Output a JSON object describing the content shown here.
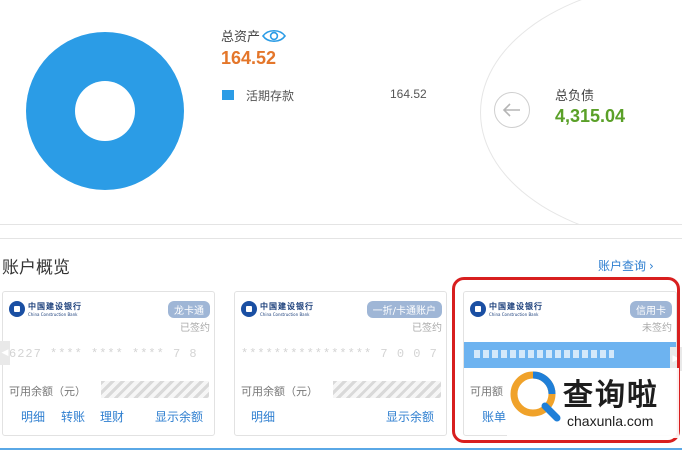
{
  "colors": {
    "donut": "#2b9ce6",
    "asset_value": "#e4762a",
    "liability_value": "#5aa028",
    "link": "#2f7fd0",
    "highlight": "#d81f1f"
  },
  "summary": {
    "asset_title": "总资产",
    "asset_value": "164.52",
    "legend": [
      {
        "label": "活期存款",
        "value": "164.52"
      }
    ],
    "liability_title": "总负债",
    "liability_value": "4,315.04"
  },
  "overview": {
    "title": "账户概览",
    "query_link": "账户查询",
    "cards": [
      {
        "bank_cn": "中国建设银行",
        "bank_en": "China Construction Bank",
        "badge": "龙卡通",
        "status": "已签约",
        "masked_number": "6227 **** **** **** 7 8",
        "balance_label": "可用余额（元）",
        "actions": [
          "明细",
          "转账",
          "理财",
          "显示余额"
        ]
      },
      {
        "bank_cn": "中国建设银行",
        "bank_en": "China Construction Bank",
        "badge": "一折/卡通账户",
        "status": "已签约",
        "masked_number": "**************** 7 0 0 7",
        "balance_label": "可用余额（元）",
        "actions": [
          "明细",
          "显示余额"
        ]
      },
      {
        "bank_cn": "中国建设银行",
        "bank_en": "China Construction Bank",
        "badge": "信用卡",
        "status": "未签约",
        "balance_label": "可用额",
        "actions": [
          "账单"
        ]
      }
    ]
  },
  "watermark": {
    "text": "查询啦",
    "domain": "chaxunla.com"
  }
}
